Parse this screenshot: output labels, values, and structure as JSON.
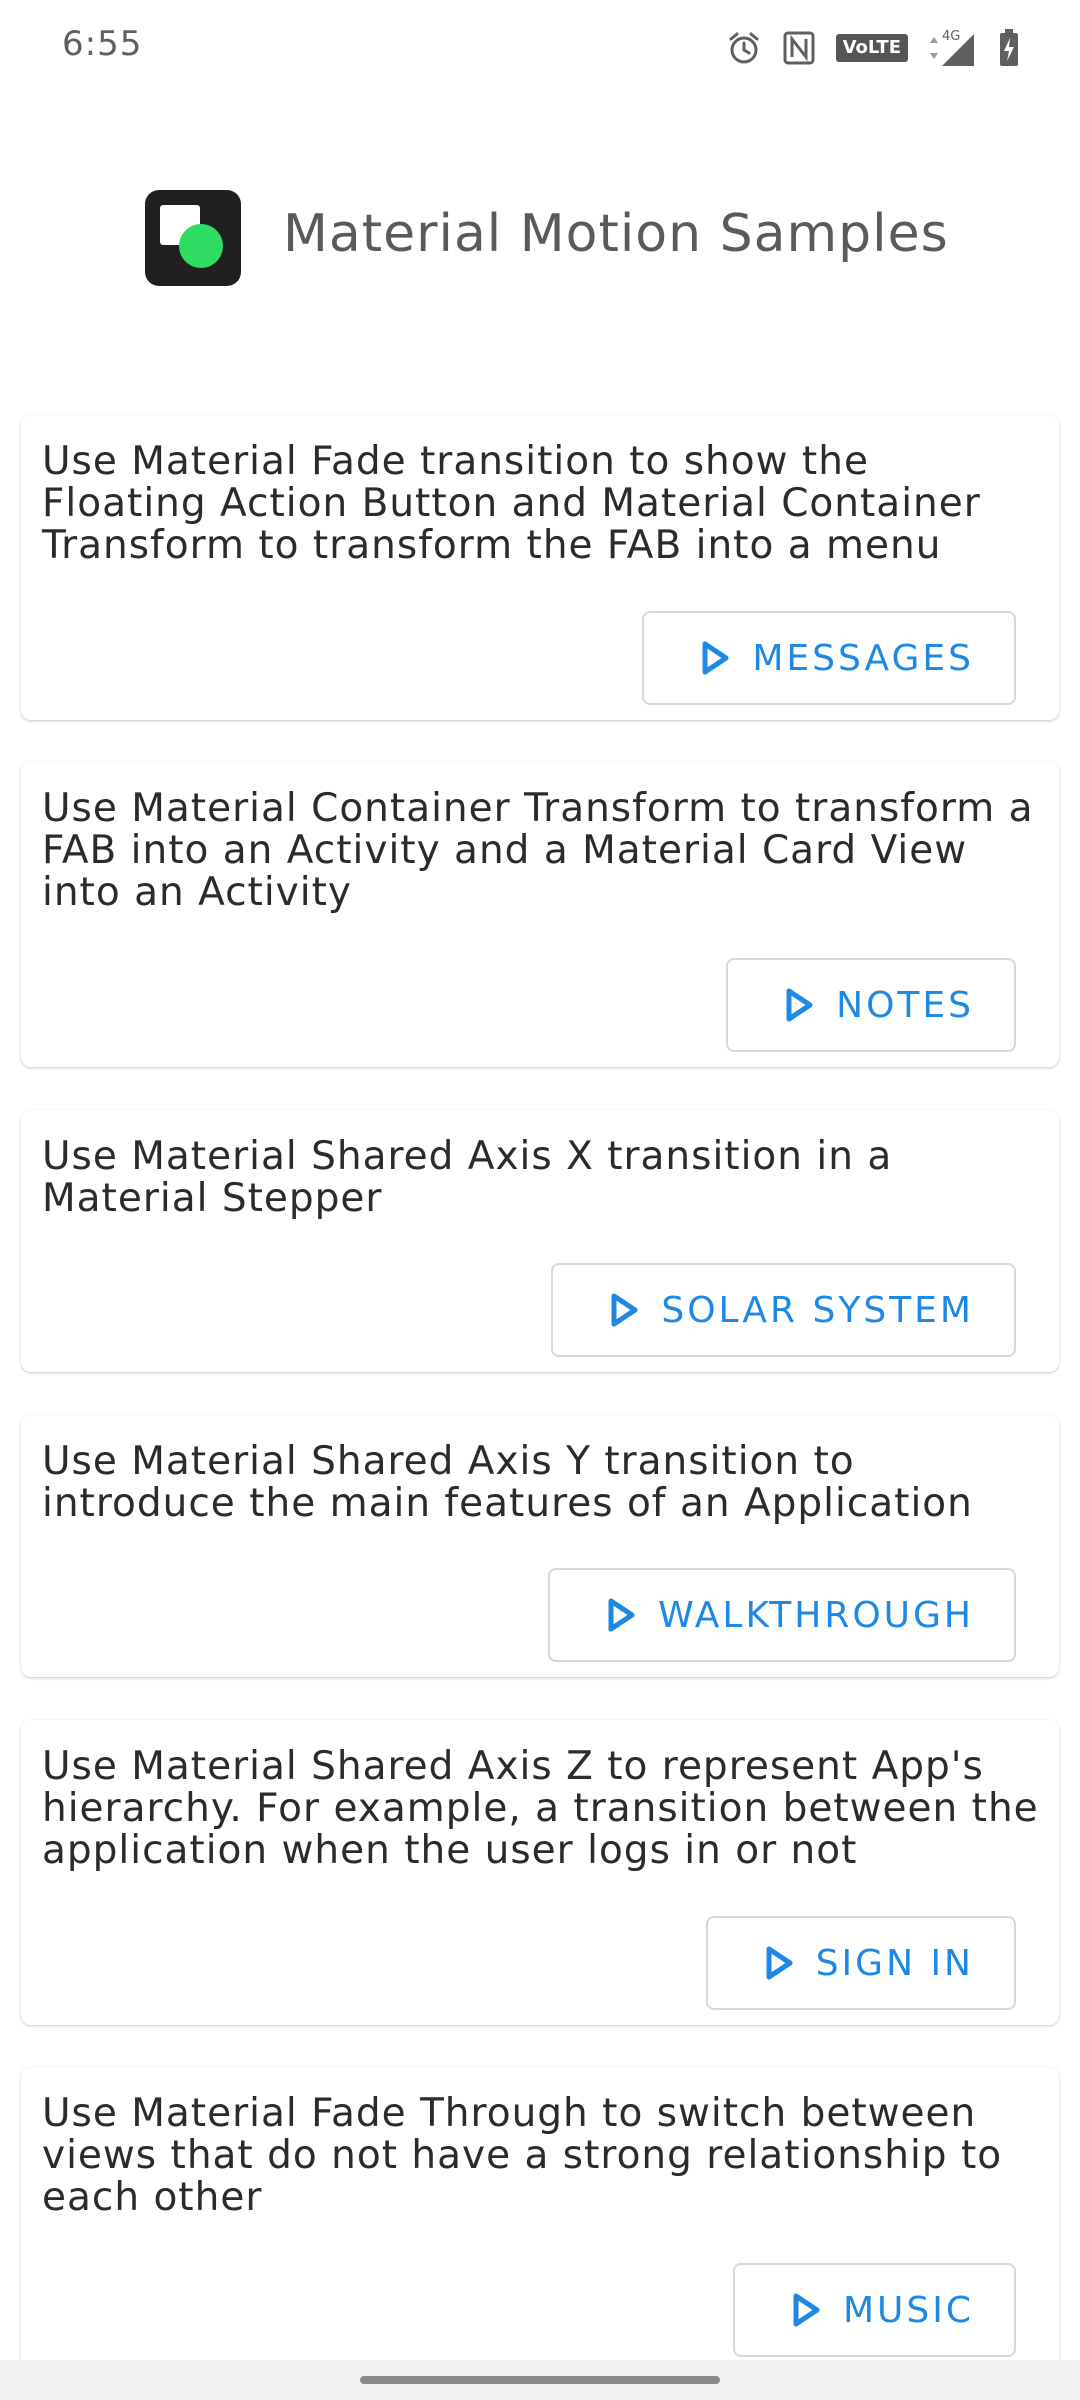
{
  "status_bar": {
    "time": "6:55",
    "volte_label": "VoLTE",
    "network_label": "4G",
    "icons": [
      "alarm-icon",
      "nfc-icon",
      "volte-icon",
      "signal-icon",
      "battery-charging-icon"
    ]
  },
  "header": {
    "title": "Material Motion Samples",
    "logo_icon": "app-logo-icon"
  },
  "colors": {
    "accent": "#1E88E5",
    "logo_bg": "#202020",
    "logo_circle": "#2FDC64",
    "text": "#2B2B2B"
  },
  "cards": [
    {
      "description": "Use Material Fade transition to show the Floating Action Button and Material Container Transform to transform the FAB into a menu",
      "button_label": "MESSAGES",
      "button_icon": "play-icon"
    },
    {
      "description": "Use Material Container Transform to transform a FAB into an Activity and a Material Card View into an Activity",
      "button_label": "NOTES",
      "button_icon": "play-icon"
    },
    {
      "description": "Use Material Shared Axis X transition in a Material Stepper",
      "button_label": "SOLAR SYSTEM",
      "button_icon": "play-icon"
    },
    {
      "description": "Use Material Shared Axis Y transition to introduce the main features of an Application",
      "button_label": "WALKTHROUGH",
      "button_icon": "play-icon"
    },
    {
      "description": "Use Material Shared Axis Z to represent App's hierarchy. For example, a transition between the application when the user logs in or not",
      "button_label": "SIGN IN",
      "button_icon": "play-icon"
    },
    {
      "description": "Use Material Fade Through to switch between views that do not have a strong relationship to each other",
      "button_label": "MUSIC",
      "button_icon": "play-icon"
    }
  ]
}
